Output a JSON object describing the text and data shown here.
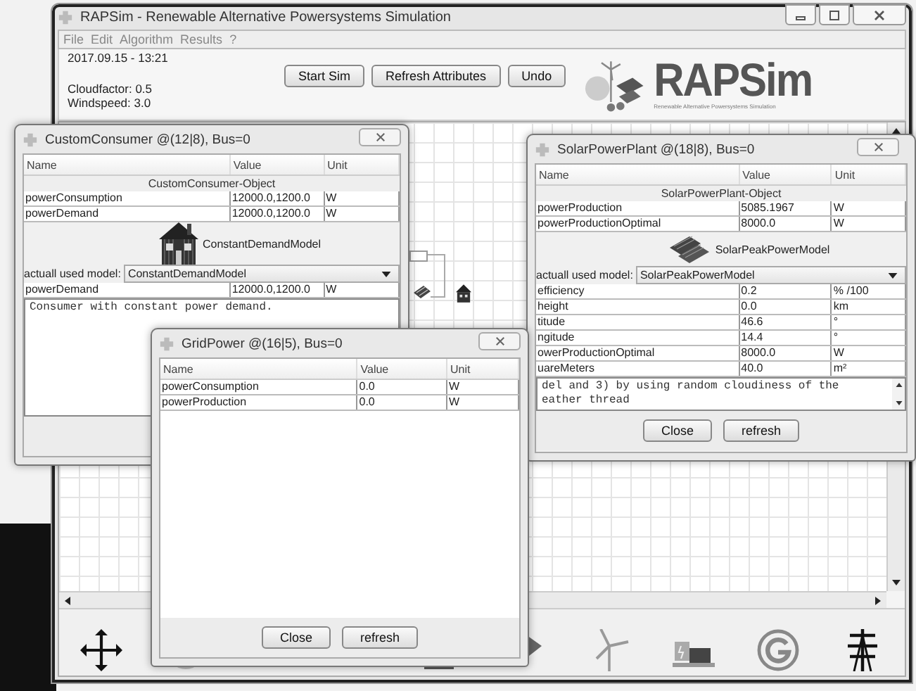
{
  "main_window": {
    "title": "RAPSim - Renewable Alternative Powersystems Simulation",
    "menu": [
      "File",
      "Edit",
      "Algorithm",
      "Results",
      "?"
    ],
    "info": {
      "datetime": "2017.09.15 - 13:21",
      "cloudfactor": "Cloudfactor: 0.5",
      "windspeed": "Windspeed: 3.0"
    },
    "buttons": [
      "Start Sim",
      "Refresh Attributes",
      "Undo"
    ],
    "logo": {
      "name": "RAPSim",
      "subtitle": "Renewable Alternative Powersystems Simulation"
    }
  },
  "dialogs": [
    {
      "title": "CustomConsumer @(12|8), Bus=0",
      "columns": [
        "Name",
        "Value",
        "Unit"
      ],
      "section": "CustomConsumer-Object",
      "rows": [
        [
          "powerConsumption",
          "12000.0,1200.0",
          "W"
        ],
        [
          "powerDemand",
          "12000.0,1200.0",
          "W"
        ]
      ],
      "model": {
        "kind": "house",
        "label": "ConstantDemandModel"
      },
      "model_select": {
        "label": "actuall used model:",
        "value": "ConstantDemandModel"
      },
      "model_rows": [
        [
          "powerDemand",
          "12000.0,1200.0",
          "W"
        ]
      ],
      "description": [
        "Consumer with constant power demand."
      ]
    },
    {
      "title": "SolarPowerPlant @(18|8), Bus=0",
      "columns": [
        "Name",
        "Value",
        "Unit"
      ],
      "section": "SolarPowerPlant-Object",
      "rows": [
        [
          "powerProduction",
          "5085.1967",
          "W"
        ],
        [
          "powerProductionOptimal",
          "8000.0",
          "W"
        ]
      ],
      "model": {
        "kind": "solar",
        "label": "SolarPeakPowerModel"
      },
      "model_select": {
        "label": "actuall used model:",
        "value": "SolarPeakPowerModel"
      },
      "model_rows": [
        [
          "efficiency",
          "0.2",
          "% /100"
        ],
        [
          "height",
          "0.0",
          "km"
        ],
        [
          "titude",
          "46.6",
          "°"
        ],
        [
          "ngitude",
          "14.4",
          "°"
        ],
        [
          "owerProductionOptimal",
          "8000.0",
          "W"
        ],
        [
          "uareMeters",
          "40.0",
          "m²"
        ]
      ],
      "description": [
        "del and 3) by using random cloudiness of the",
        "eather thread"
      ],
      "buttons": [
        "Close",
        "refresh"
      ]
    },
    {
      "title": "GridPower @(16|5), Bus=0",
      "columns": [
        "Name",
        "Value",
        "Unit"
      ],
      "rows": [
        [
          "powerConsumption",
          "0.0",
          "W"
        ],
        [
          "powerProduction",
          "0.0",
          "W"
        ]
      ],
      "buttons": [
        "Close",
        "refresh"
      ]
    }
  ]
}
